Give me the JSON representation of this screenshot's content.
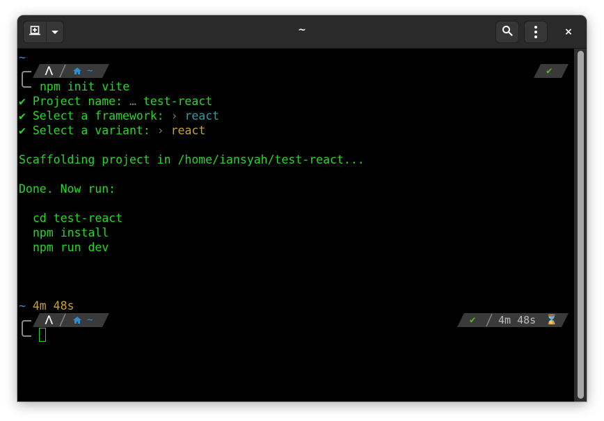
{
  "window": {
    "title": "~"
  },
  "headerbar": {
    "new_tab_icon": "new-tab-icon",
    "dropdown_icon": "chevron-down-icon",
    "search_icon": "search-icon",
    "menu_icon": "kebab-menu-icon",
    "close_label": "×"
  },
  "terminal": {
    "cwd_line_1": "~",
    "prompt_1": {
      "os_icon": "⋀",
      "home_icon": "home-icon",
      "path": "~",
      "status_ok": "✔"
    },
    "command_1": "npm init vite",
    "prompts": [
      {
        "check": "✔",
        "label": "Project name:",
        "sep": "…",
        "value": "test-react"
      },
      {
        "check": "✔",
        "label": "Select a framework:",
        "sep": "›",
        "value": "react"
      },
      {
        "check": "✔",
        "label": "Select a variant:",
        "sep": "›",
        "value": "react"
      }
    ],
    "scaffolding": "Scaffolding project in /home/iansyah/test-react...",
    "done": "Done. Now run:",
    "next_steps": [
      "cd test-react",
      "npm install",
      "npm run dev"
    ],
    "cwd_line_2": "~",
    "duration_line": "4m 48s",
    "prompt_2": {
      "os_icon": "⋀",
      "home_icon": "home-icon",
      "path": "~",
      "status_ok": "✔",
      "duration": "4m 48s",
      "hourglass": "⌛"
    }
  },
  "colors": {
    "terminal_bg": "#000000",
    "text_green": "#2ad52a",
    "framework_teal": "#2aa0a8",
    "variant_yellow": "#c8a22a",
    "path_blue": "#3a8fd0",
    "segment_bg": "#3a3a3a",
    "headerbar_bg": "#2a2a2a"
  }
}
